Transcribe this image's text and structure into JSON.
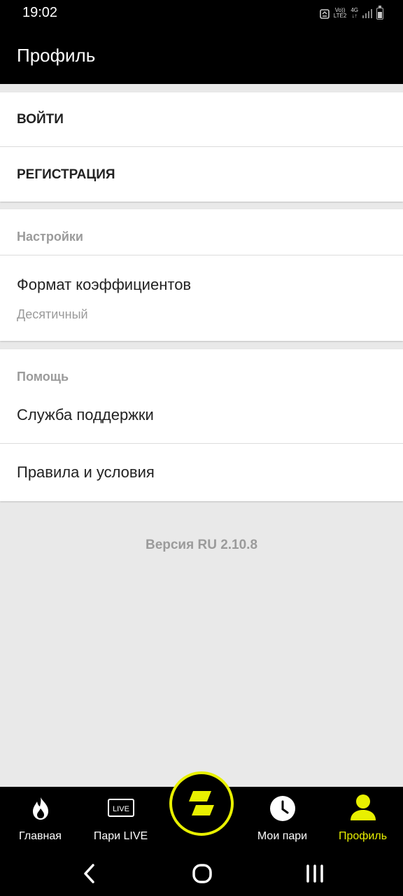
{
  "status_bar": {
    "time": "19:02",
    "volte_label": "Vo))",
    "lte_label": "LTE2",
    "net_label": "4G",
    "net_arrows": "↓↑"
  },
  "header": {
    "title": "Профиль"
  },
  "auth": {
    "login_label": "ВОЙТИ",
    "register_label": "РЕГИСТРАЦИЯ"
  },
  "settings": {
    "title": "Настройки",
    "odds_format_label": "Формат коэффициентов",
    "odds_format_value": "Десятичный"
  },
  "help": {
    "title": "Помощь",
    "support_label": "Служба поддержки",
    "terms_label": "Правила и условия"
  },
  "version_text": "Версия RU 2.10.8",
  "bottom_nav": {
    "items": [
      {
        "label": "Главная",
        "icon": "fire-icon"
      },
      {
        "label": "Пари LIVE",
        "icon": "live-icon",
        "badge": "LIVE"
      },
      {
        "label": "Мои пари",
        "icon": "clock-icon"
      },
      {
        "label": "Профиль",
        "icon": "person-icon"
      }
    ],
    "active_index": 3,
    "center_icon": "brand-logo-icon"
  },
  "colors": {
    "accent": "#e8f000",
    "bar_bg": "#000000",
    "page_bg": "#e9e9e9",
    "muted_text": "#9b9b9b"
  }
}
